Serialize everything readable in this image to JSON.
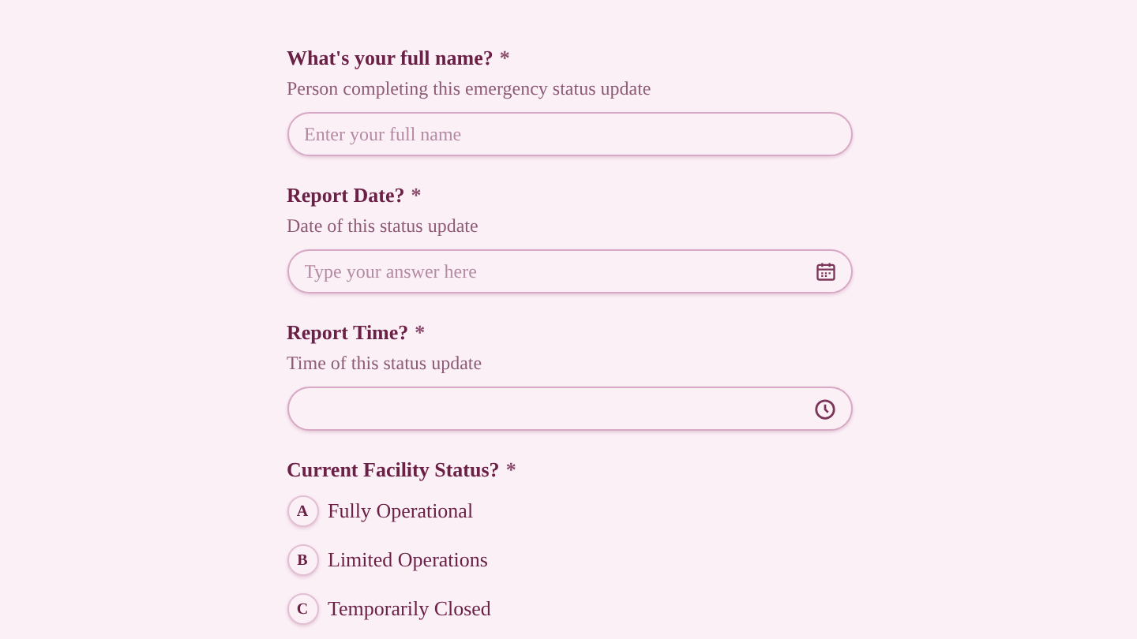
{
  "questions": [
    {
      "kind": "text",
      "title": "What's your full name?",
      "required_mark": "*",
      "description": "Person completing this emergency status update",
      "placeholder": "Enter your full name"
    },
    {
      "kind": "date",
      "title": "Report Date?",
      "required_mark": "*",
      "description": "Date of this status update",
      "placeholder": "Type your answer here"
    },
    {
      "kind": "time",
      "title": "Report Time?",
      "required_mark": "*",
      "description": "Time of this status update"
    },
    {
      "kind": "choice",
      "title": "Current Facility Status?",
      "required_mark": "*",
      "options": [
        {
          "key": "A",
          "label": "Fully Operational",
          "selected": false
        },
        {
          "key": "B",
          "label": "Limited Operations",
          "selected": false
        },
        {
          "key": "C",
          "label": "Temporarily Closed",
          "selected": false
        }
      ]
    }
  ]
}
